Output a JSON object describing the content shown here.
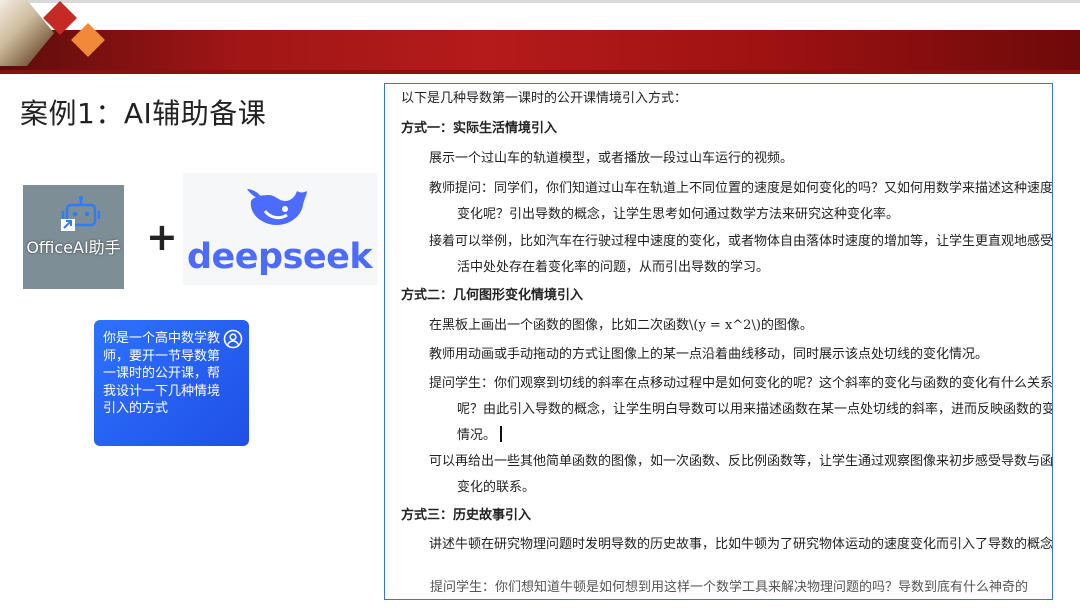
{
  "slide": {
    "title": "案例1：AI辅助备课",
    "brand_colors": {
      "banner": "#a11616",
      "accent_orange": "#f08a3a",
      "deepseek_blue": "#4d6bfe",
      "bubble_blue": "#2e72ff"
    }
  },
  "tools": {
    "office_label": "OfficeAI助手",
    "plus": "+",
    "deepseek_word": "deepseek",
    "office_icon": "robot-icon",
    "deepseek_icon": "whale-icon"
  },
  "prompt": {
    "text": "你是一个高中数学教师，要开一节导数第一课时的公开课，帮我设计一下几种情境引入的方式",
    "icon": "user-icon"
  },
  "document": {
    "intro": "以下是几种导数第一课时的公开课情境引入方式：",
    "sections": [
      {
        "heading": "方式一：实际生活情境引入",
        "paragraphs": [
          "展示一个过山车的轨道模型，或者播放一段过山车运行的视频。",
          "教师提问：同学们，你们知道过山车在轨道上不同位置的速度是如何变化的吗？又如何用数学来描述这种速度的变化呢？引出导数的概念，让学生思考如何通过数学方法来研究这种变化率。",
          "接着可以举例，比如汽车在行驶过程中速度的变化，或者物体自由落体时速度的增加等，让学生更直观地感受生活中处处存在着变化率的问题，从而引出导数的学习。"
        ]
      },
      {
        "heading": "方式二：几何图形变化情境引入",
        "paragraphs": [
          "在黑板上画出一个函数的图像，比如二次函数\\(y = x^2\\)的图像。",
          "教师用动画或手动拖动的方式让图像上的某一点沿着曲线移动，同时展示该点处切线的变化情况。",
          "提问学生：你们观察到切线的斜率在点移动过程中是如何变化的呢？这个斜率的变化与函数的变化有什么关系呢？由此引入导数的概念，让学生明白导数可以用来描述函数在某一点处切线的斜率，进而反映函数的变化情况。",
          "可以再给出一些其他简单函数的图像，如一次函数、反比例函数等，让学生通过观察图像来初步感受导数与函数变化的联系。"
        ]
      },
      {
        "heading": "方式三：历史故事引入",
        "paragraphs": [
          "讲述牛顿在研究物理问题时发明导数的历史故事，比如牛顿为了研究物体运动的速度变化而引入了导数的概念。"
        ]
      }
    ],
    "cut_line": "提问学生：你们想知道牛顿是如何想到用这样一个数学工具来解决物理问题的吗？导数到底有什么神奇的"
  }
}
